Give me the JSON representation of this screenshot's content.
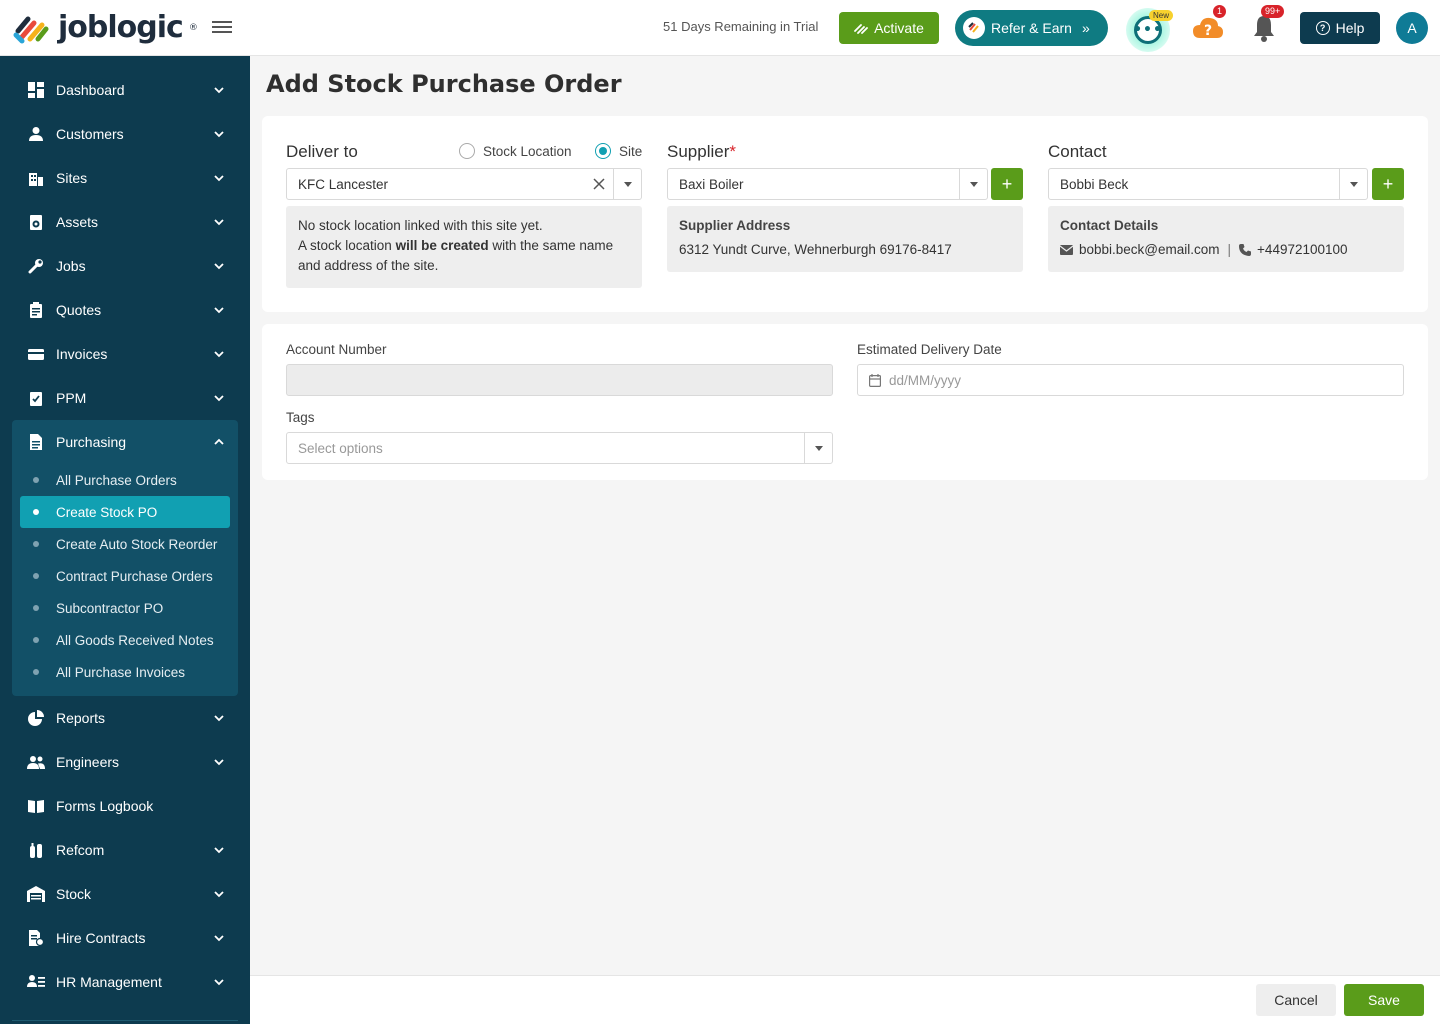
{
  "header": {
    "logo_text": "joblogic",
    "logo_reg": "®",
    "trial_text": "51 Days Remaining in Trial",
    "activate_label": "Activate",
    "refer_label": "Refer & Earn",
    "chat_badge": "New",
    "help_badge": "1",
    "notif_badge": "99+",
    "help_label": "Help",
    "avatar_initial": "A"
  },
  "sidebar": {
    "items": [
      {
        "label": "Dashboard",
        "icon": "dashboard-icon"
      },
      {
        "label": "Customers",
        "icon": "person-icon"
      },
      {
        "label": "Sites",
        "icon": "building-icon"
      },
      {
        "label": "Assets",
        "icon": "asset-icon"
      },
      {
        "label": "Jobs",
        "icon": "wrench-icon"
      },
      {
        "label": "Quotes",
        "icon": "clipboard-icon"
      },
      {
        "label": "Invoices",
        "icon": "card-icon"
      },
      {
        "label": "PPM",
        "icon": "checklist-icon"
      },
      {
        "label": "Purchasing",
        "icon": "document-icon"
      },
      {
        "label": "Reports",
        "icon": "pie-chart-icon"
      },
      {
        "label": "Engineers",
        "icon": "people-icon"
      },
      {
        "label": "Forms Logbook",
        "icon": "book-icon"
      },
      {
        "label": "Refcom",
        "icon": "cylinder-icon"
      },
      {
        "label": "Stock",
        "icon": "warehouse-icon"
      },
      {
        "label": "Hire Contracts",
        "icon": "contract-icon"
      },
      {
        "label": "HR Management",
        "icon": "hr-icon"
      }
    ],
    "purchasing_sub": [
      "All Purchase Orders",
      "Create Stock PO",
      "Create Auto Stock Reorder",
      "Contract Purchase Orders",
      "Subcontractor PO",
      "All Goods Received Notes",
      "All Purchase Invoices"
    ]
  },
  "page": {
    "title": "Add Stock Purchase Order",
    "deliver_to": {
      "label": "Deliver to",
      "radio_stock": "Stock Location",
      "radio_site": "Site",
      "value": "KFC Lancester",
      "info_line1": "No stock location linked with this site yet.",
      "info_line2_a": "A stock location ",
      "info_line2_b": "will be created",
      "info_line2_c": " with the same name",
      "info_line3": "and address of the site."
    },
    "supplier": {
      "label": "Supplier",
      "required": "*",
      "value": "Baxi Boiler",
      "address_title": "Supplier Address",
      "address": "6312 Yundt Curve, Wehnerburgh 69176-8417"
    },
    "contact": {
      "label": "Contact",
      "value": "Bobbi Beck",
      "details_title": "Contact Details",
      "email": "bobbi.beck@email.com",
      "separator": "|",
      "phone": "+44972100100"
    },
    "account_number": {
      "label": "Account Number",
      "value": ""
    },
    "delivery_date": {
      "label": "Estimated Delivery Date",
      "placeholder": "dd/MM/yyyy"
    },
    "tags": {
      "label": "Tags",
      "placeholder": "Select options"
    }
  },
  "footer": {
    "cancel_label": "Cancel",
    "save_label": "Save"
  },
  "colors": {
    "sidebar": "#0d3b4f",
    "accent": "#11a0b2",
    "green": "#5a9c1a"
  }
}
